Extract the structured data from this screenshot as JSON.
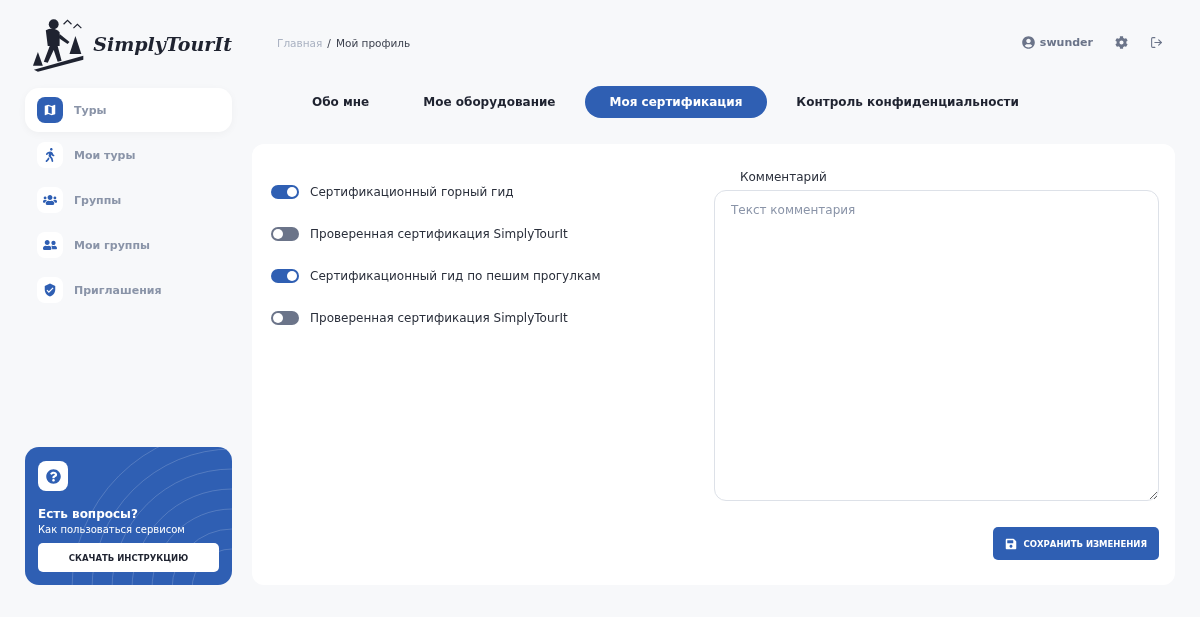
{
  "logo": {
    "text": "SimplyTourIt"
  },
  "breadcrumb": [
    {
      "label": "Главная",
      "current": false
    },
    {
      "label": "Мой профиль",
      "current": true
    }
  ],
  "breadcrumb_separator": "/",
  "user": {
    "name": "swunder"
  },
  "sidebar": {
    "items": [
      {
        "label": "Туры",
        "selected": true
      },
      {
        "label": "Мои туры",
        "selected": false
      },
      {
        "label": "Группы",
        "selected": false
      },
      {
        "label": "Мои группы",
        "selected": false
      },
      {
        "label": "Приглашения",
        "selected": false
      }
    ]
  },
  "help": {
    "title": "Есть вопросы?",
    "subtitle": "Как пользоваться сервисом",
    "button": "СКАЧАТЬ ИНСТРУКЦИЮ"
  },
  "tabs": [
    {
      "label": "Обо мне",
      "selected": false
    },
    {
      "label": "Мое оборудование",
      "selected": false
    },
    {
      "label": "Моя сертификация",
      "selected": true
    },
    {
      "label": "Контроль конфиденциальности",
      "selected": false
    }
  ],
  "certifications": [
    {
      "label": "Сертификационный горный гид",
      "on": true
    },
    {
      "label": "Проверенная сертификация SimplyTourIt",
      "on": false
    },
    {
      "label": "Сертификационный гид по пешим прогулкам",
      "on": true
    },
    {
      "label": "Проверенная сертификация SimplyTourIt",
      "on": false
    }
  ],
  "comment": {
    "label": "Комментарий",
    "placeholder": "Текст комментария"
  },
  "save_button": "СОХРАНИТЬ ИЗМЕНЕНИЯ"
}
